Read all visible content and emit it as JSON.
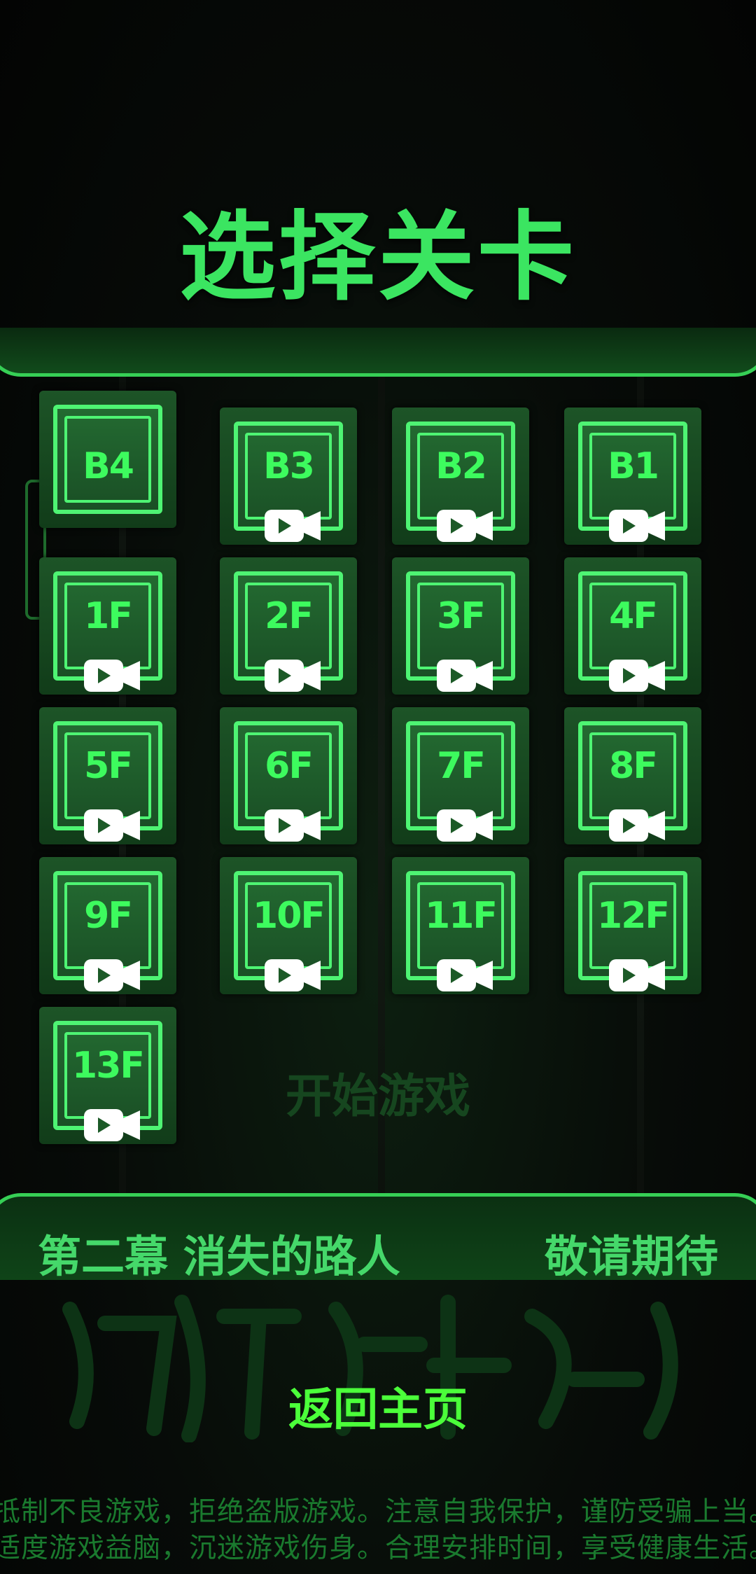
{
  "title": "选择关卡",
  "levels": [
    {
      "label": "B4",
      "video": false
    },
    {
      "label": "B3",
      "video": true
    },
    {
      "label": "B2",
      "video": true
    },
    {
      "label": "B1",
      "video": true
    },
    {
      "label": "1F",
      "video": true
    },
    {
      "label": "2F",
      "video": true
    },
    {
      "label": "3F",
      "video": true
    },
    {
      "label": "4F",
      "video": true
    },
    {
      "label": "5F",
      "video": true
    },
    {
      "label": "6F",
      "video": true
    },
    {
      "label": "7F",
      "video": true
    },
    {
      "label": "8F",
      "video": true
    },
    {
      "label": "9F",
      "video": true
    },
    {
      "label": "10F",
      "video": true
    },
    {
      "label": "11F",
      "video": true
    },
    {
      "label": "12F",
      "video": true
    },
    {
      "label": "13F",
      "video": true
    }
  ],
  "watermark_text": "开始游戏",
  "chapter": {
    "name": "第二幕 消失的路人",
    "status": "敬请期待"
  },
  "home_button_label": "返回主页",
  "notice": {
    "line1": "抵制不良游戏，拒绝盗版游戏。注意自我保护，谨防受骗上当。",
    "line2": "适度游戏益脑，沉迷游戏伤身。合理安排时间，享受健康生活。"
  },
  "icons": {
    "video": "video-camera-icon"
  },
  "colors": {
    "accent": "#3be561",
    "tile_border": "#4ef473",
    "home_button": "#4bff3a"
  }
}
